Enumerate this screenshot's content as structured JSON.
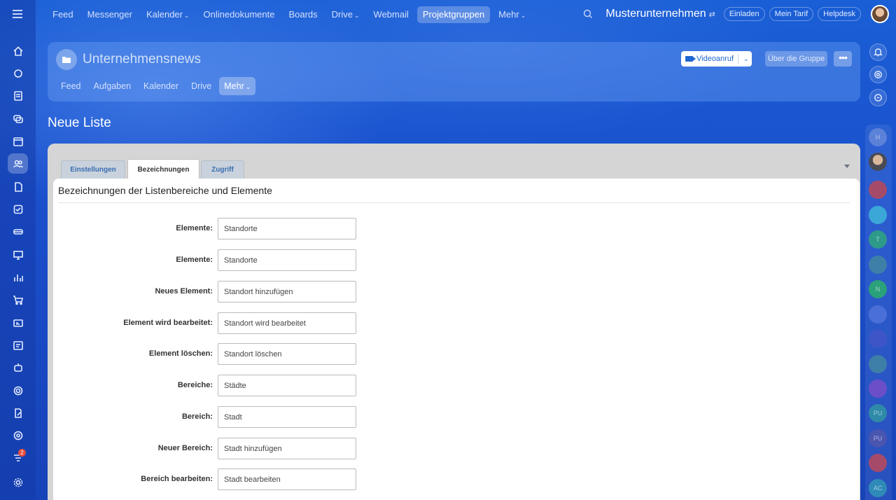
{
  "topnav": {
    "items": [
      {
        "label": "Feed"
      },
      {
        "label": "Messenger"
      },
      {
        "label": "Kalender",
        "dropdown": true
      },
      {
        "label": "Onlinedokumente"
      },
      {
        "label": "Boards"
      },
      {
        "label": "Drive",
        "dropdown": true
      },
      {
        "label": "Webmail"
      },
      {
        "label": "Projektgruppen",
        "active": true
      },
      {
        "label": "Mehr",
        "dropdown": true
      }
    ],
    "company": "Musterunternehmen",
    "invite": "Einladen",
    "tariff": "Mein Tarif",
    "helpdesk": "Helpdesk"
  },
  "left_sidebar": {
    "icons": [
      "home-icon",
      "puzzle-icon",
      "document-icon",
      "chat-icon",
      "calendar-icon",
      "users-icon",
      "page-icon",
      "checkbox-icon",
      "stack-icon",
      "presentation-icon",
      "chart-icon",
      "cart-icon",
      "card-icon",
      "schedule-icon",
      "robot-icon",
      "target-icon",
      "edit-doc-icon",
      "lifebuoy-icon",
      "feed-filter-icon",
      "settings-icon"
    ],
    "notification_badge": "2"
  },
  "group": {
    "title": "Unternehmensnews",
    "tabs": [
      {
        "label": "Feed"
      },
      {
        "label": "Aufgaben"
      },
      {
        "label": "Kalender"
      },
      {
        "label": "Drive"
      },
      {
        "label": "Mehr",
        "active": true
      }
    ],
    "video_call": "Videoanruf",
    "about": "Über die Gruppe"
  },
  "page_title": "Neue Liste",
  "tabs": [
    {
      "label": "Einstellungen"
    },
    {
      "label": "Bezeichnungen",
      "active": true
    },
    {
      "label": "Zugriff"
    }
  ],
  "form": {
    "heading": "Bezeichnungen der Listenbereiche und Elemente",
    "rows": [
      {
        "label": "Elemente:",
        "value": "Standorte"
      },
      {
        "label": "Elemente:",
        "value": "Standorte"
      },
      {
        "label": "Neues Element:",
        "value": "Standort hinzufügen"
      },
      {
        "label": "Element wird bearbeitet:",
        "value": "Standort wird bearbeitet"
      },
      {
        "label": "Element löschen:",
        "value": "Standort löschen"
      },
      {
        "label": "Bereiche:",
        "value": "Städte"
      },
      {
        "label": "Bereich:",
        "value": "Stadt"
      },
      {
        "label": "Neuer Bereich:",
        "value": "Stadt hinzufügen"
      },
      {
        "label": "Bereich bearbeiten:",
        "value": "Stadt bearbeiten"
      }
    ]
  },
  "right_sidebar": {
    "avatars": [
      "H",
      "",
      "",
      "",
      "T",
      "",
      "N",
      "",
      "",
      "",
      "",
      "PU",
      "PU",
      "",
      "AC"
    ]
  },
  "colors": {
    "accent": "#2066d0",
    "background": "#1b4fcc"
  }
}
